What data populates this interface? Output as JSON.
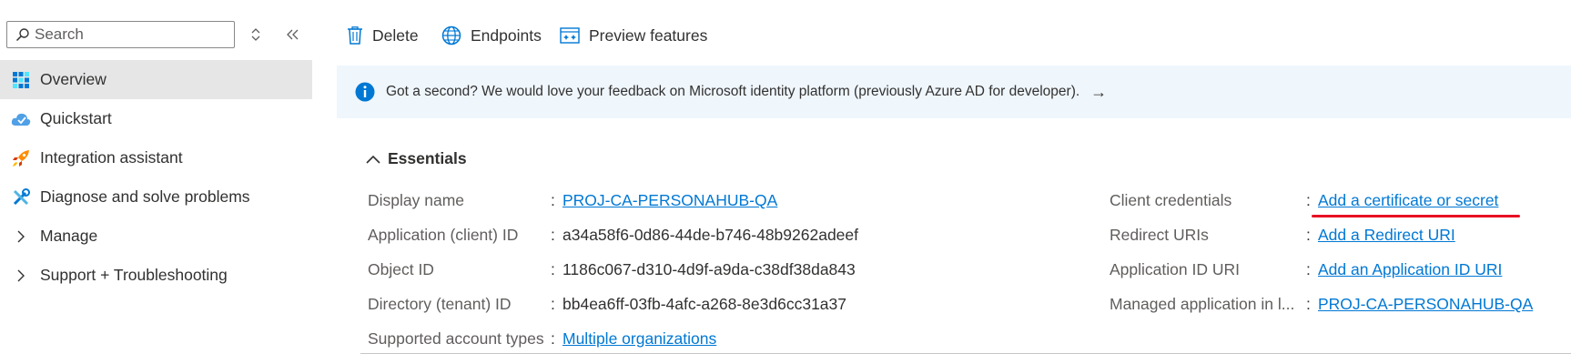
{
  "sidebar": {
    "search_placeholder": "Search",
    "items": [
      {
        "label": "Overview"
      },
      {
        "label": "Quickstart"
      },
      {
        "label": "Integration assistant"
      },
      {
        "label": "Diagnose and solve problems"
      },
      {
        "label": "Manage"
      },
      {
        "label": "Support + Troubleshooting"
      }
    ]
  },
  "toolbar": {
    "delete_label": "Delete",
    "endpoints_label": "Endpoints",
    "preview_label": "Preview features"
  },
  "banner": {
    "text": "Got a second? We would love your feedback on Microsoft identity platform (previously Azure AD for developer).",
    "arrow": "→"
  },
  "essentials": {
    "title": "Essentials",
    "left": [
      {
        "label": "Display name",
        "value": "PROJ-CA-PERSONAHUB-QA"
      },
      {
        "label": "Application (client) ID",
        "value": "a34a58f6-0d86-44de-b746-48b9262adeef"
      },
      {
        "label": "Object ID",
        "value": "1186c067-d310-4d9f-a9da-c38df38da843"
      },
      {
        "label": "Directory (tenant) ID",
        "value": "bb4ea6ff-03fb-4afc-a268-8e3d6cc31a37"
      },
      {
        "label": "Supported account types",
        "value": "Multiple organizations"
      }
    ],
    "right": [
      {
        "label": "Client credentials",
        "value": "Add a certificate or secret"
      },
      {
        "label": "Redirect URIs",
        "value": "Add a Redirect URI"
      },
      {
        "label": "Application ID URI",
        "value": "Add an Application ID URI"
      },
      {
        "label": "Managed application in l...",
        "value": "PROJ-CA-PERSONAHUB-QA"
      }
    ],
    "colon": ":"
  },
  "colors": {
    "link": "#0078d4",
    "accent_underline": "#e81123",
    "banner_bg": "#eff6fc",
    "active_nav_bg": "#e6e6e6"
  }
}
